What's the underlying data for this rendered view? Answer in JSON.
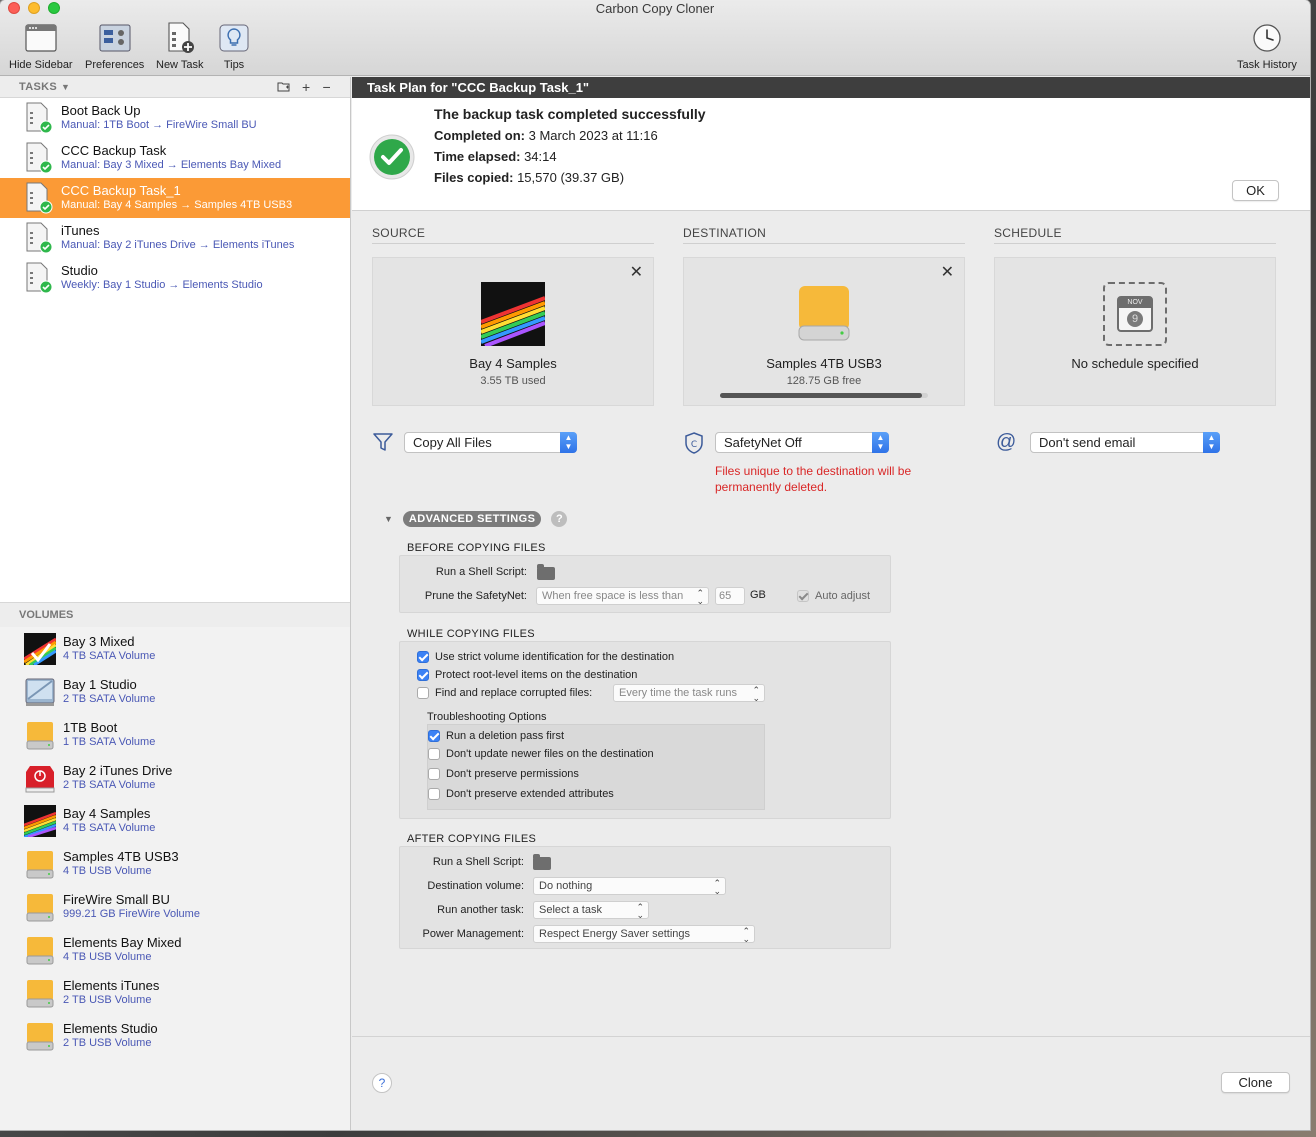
{
  "window": {
    "title": "Carbon Copy Cloner"
  },
  "toolbar": {
    "hide_sidebar": "Hide Sidebar",
    "preferences": "Preferences",
    "new_task": "New Task",
    "tips": "Tips",
    "task_history": "Task History"
  },
  "sidebar": {
    "tasks_header": "TASKS",
    "tasks": [
      {
        "name": "Boot Back Up",
        "sub": "Manual: 1TB Boot → FireWire Small BU"
      },
      {
        "name": "CCC Backup Task",
        "sub": "Manual: Bay 3 Mixed → Elements Bay Mixed"
      },
      {
        "name": "CCC Backup Task_1",
        "sub": "Manual: Bay 4 Samples → Samples 4TB USB3"
      },
      {
        "name": "iTunes",
        "sub": "Manual: Bay 2 iTunes Drive → Elements iTunes"
      },
      {
        "name": "Studio",
        "sub": "Weekly: Bay 1 Studio → Elements Studio"
      }
    ],
    "volumes_header": "VOLUMES",
    "volumes": [
      {
        "name": "Bay 3 Mixed",
        "sub": "4 TB SATA Volume",
        "icon": "rainbow-volume-icon"
      },
      {
        "name": "Bay 1 Studio",
        "sub": "2 TB SATA Volume",
        "icon": "studio-volume-icon"
      },
      {
        "name": "1TB Boot",
        "sub": "1 TB SATA Volume",
        "icon": "drive-icon"
      },
      {
        "name": "Bay 2 iTunes Drive",
        "sub": "2 TB SATA Volume",
        "icon": "red-drive-icon"
      },
      {
        "name": "Bay 4 Samples",
        "sub": "4 TB SATA Volume",
        "icon": "rainbow-volume-icon"
      },
      {
        "name": "Samples 4TB USB3",
        "sub": "4 TB USB Volume",
        "icon": "drive-icon"
      },
      {
        "name": "FireWire Small BU",
        "sub": "999.21 GB FireWire Volume",
        "icon": "drive-icon"
      },
      {
        "name": "Elements Bay Mixed",
        "sub": "4 TB USB Volume",
        "icon": "drive-icon"
      },
      {
        "name": "Elements iTunes",
        "sub": "2 TB USB Volume",
        "icon": "drive-icon"
      },
      {
        "name": "Elements Studio",
        "sub": "2 TB USB Volume",
        "icon": "drive-icon"
      }
    ]
  },
  "main": {
    "plan_title": "Task Plan for \"CCC Backup Task_1\"",
    "status": {
      "heading": "The backup task completed successfully",
      "completed_label": "Completed on:",
      "completed_value": " 3 March 2023 at 11:16",
      "elapsed_label": "Time elapsed:",
      "elapsed_value": " 34:14",
      "copied_label": "Files copied:",
      "copied_value": " 15,570 (39.37 GB)",
      "ok_label": "OK"
    },
    "source": {
      "header": "SOURCE",
      "name": "Bay 4 Samples",
      "sub": "3.55 TB used",
      "filter_value": "Copy All Files"
    },
    "destination": {
      "header": "DESTINATION",
      "name": "Samples 4TB USB3",
      "sub": "128.75 GB free",
      "usage_fraction": 0.97,
      "safetynet_value": "SafetyNet Off",
      "warning_line1": "Files unique to the destination will be",
      "warning_line2": "permanently deleted."
    },
    "schedule": {
      "header": "SCHEDULE",
      "month": "NOV",
      "day": "9",
      "text": "No schedule specified",
      "email_value": "Don't send email"
    },
    "advanced": {
      "label": "ADVANCED SETTINGS",
      "help": "?",
      "before": {
        "title": "BEFORE COPYING FILES",
        "shell_label": "Run a Shell Script:",
        "prune_label": "Prune the SafetyNet:",
        "prune_value": "When free space is less than",
        "prune_num": "65",
        "prune_unit": "GB",
        "auto_adjust": "Auto adjust"
      },
      "while": {
        "title": "WHILE COPYING FILES",
        "strict": "Use strict volume identification for the destination",
        "protect": "Protect root-level items on the destination",
        "find_replace": "Find and replace corrupted files:",
        "find_value": "Every time the task runs",
        "troubleshoot_title": "Troubleshooting Options",
        "deletion_pass": "Run a deletion pass first",
        "no_update_newer": "Don't update newer files on the destination",
        "no_permissions": "Don't preserve permissions",
        "no_ext_attrs": "Don't preserve extended attributes"
      },
      "after": {
        "title": "AFTER COPYING FILES",
        "shell_label": "Run a Shell Script:",
        "dest_label": "Destination volume:",
        "dest_value": "Do nothing",
        "another_label": "Run another task:",
        "another_value": "Select a task",
        "power_label": "Power Management:",
        "power_value": "Respect Energy Saver settings"
      }
    },
    "footer": {
      "help": "?",
      "clone_label": "Clone"
    }
  }
}
